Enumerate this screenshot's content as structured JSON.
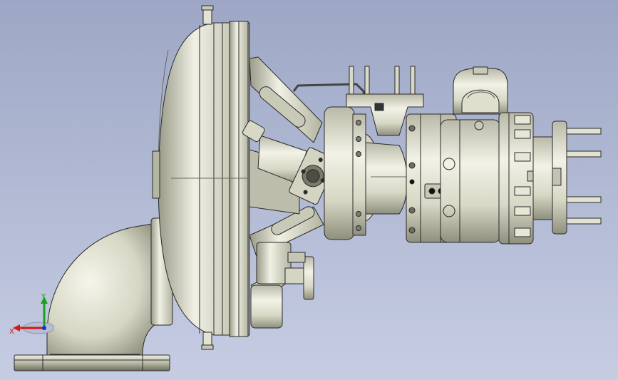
{
  "viewport": {
    "background_top": "#9da7c5",
    "background_bottom": "#c6cde3"
  },
  "model": {
    "part_color": "#dcdccb",
    "part_shadow": "#8f8f7e",
    "edge_color": "#2a2a2a"
  },
  "triad": {
    "x_label": "X",
    "y_label": "Y",
    "x_color": "#d01a1a",
    "y_color": "#1aa01a",
    "z_color": "#1a2fd0"
  }
}
